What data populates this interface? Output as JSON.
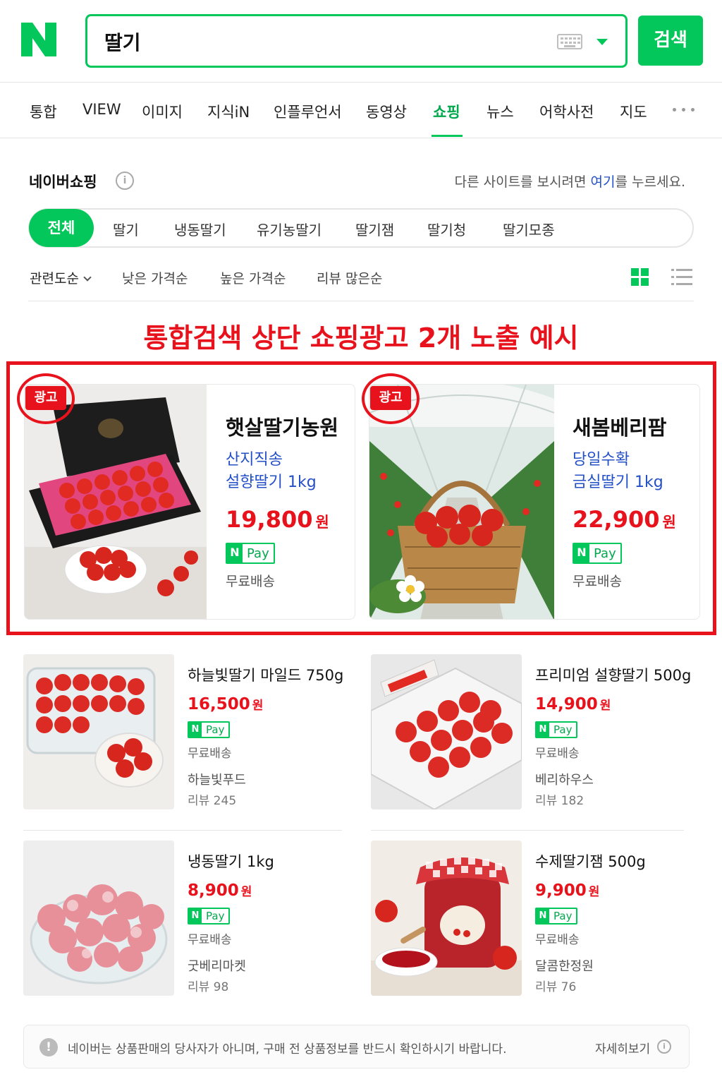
{
  "search": {
    "query": "딸기",
    "button_label": "검색",
    "brand_color": "#03c75a"
  },
  "tabs": [
    {
      "label": "통합"
    },
    {
      "label": "VIEW"
    },
    {
      "label": "이미지"
    },
    {
      "label": "지식iN"
    },
    {
      "label": "인플루언서"
    },
    {
      "label": "동영상"
    },
    {
      "label": "쇼핑",
      "active": true
    },
    {
      "label": "뉴스"
    },
    {
      "label": "어학사전"
    },
    {
      "label": "지도"
    }
  ],
  "section": {
    "title": "네이버쇼핑",
    "notice_before": "다른 사이트를 보시려면 ",
    "notice_link": "여기",
    "notice_after": "를 누르세요."
  },
  "chips": [
    "전체",
    "딸기",
    "냉동딸기",
    "유기농딸기",
    "딸기잼",
    "딸기청",
    "딸기모종"
  ],
  "sort": [
    "관련도순",
    "낮은 가격순",
    "높은 가격순",
    "리뷰 많은순"
  ],
  "annotation": "통합검색 상단 쇼핑광고 2개 노출 예시",
  "ads": [
    {
      "badge": "광고",
      "name": "햇살딸기농원",
      "desc1": "산지직송",
      "desc2": "설향딸기 1kg",
      "price": "19,800",
      "currency": "원",
      "pay_n": "N",
      "pay": "Pay",
      "shipping": "무료배송"
    },
    {
      "badge": "광고",
      "name": "새봄베리팜",
      "desc1": "당일수확",
      "desc2": "금실딸기 1kg",
      "price": "22,900",
      "currency": "원",
      "pay_n": "N",
      "pay": "Pay",
      "shipping": "무료배송"
    }
  ],
  "products": [
    {
      "name": "하늘빛딸기 마일드 750g",
      "price": "16,500",
      "currency": "원",
      "pay_n": "N",
      "pay": "Pay",
      "shipping": "무료배송",
      "seller": "하늘빛푸드",
      "review": "리뷰 245"
    },
    {
      "name": "프리미엄 설향딸기 500g",
      "price": "14,900",
      "currency": "원",
      "pay_n": "N",
      "pay": "Pay",
      "shipping": "무료배송",
      "seller": "베리하우스",
      "review": "리뷰 182"
    },
    {
      "name": "냉동딸기 1kg",
      "price": "8,900",
      "currency": "원",
      "pay_n": "N",
      "pay": "Pay",
      "shipping": "무료배송",
      "seller": "굿베리마켓",
      "review": "리뷰 98"
    },
    {
      "name": "수제딸기잼 500g",
      "price": "9,900",
      "currency": "원",
      "pay_n": "N",
      "pay": "Pay",
      "shipping": "무료배송",
      "seller": "달콤한정원",
      "review": "리뷰 76"
    }
  ],
  "footer": {
    "notice": "네이버는 상품판매의 당사자가 아니며, 구매 전 상품정보를 반드시 확인하시기 바랍니다.",
    "more": "자세히보기"
  },
  "colors": {
    "accent": "#03c75a",
    "price": "#e8121c",
    "link": "#2450c7",
    "annotation": "#e8121c"
  },
  "icons": [
    "naver-logo-icon",
    "keyboard-icon",
    "dropdown-icon",
    "more-dots-icon",
    "info-icon",
    "chevron-down-icon",
    "grid-view-icon",
    "list-view-icon",
    "warning-icon"
  ]
}
